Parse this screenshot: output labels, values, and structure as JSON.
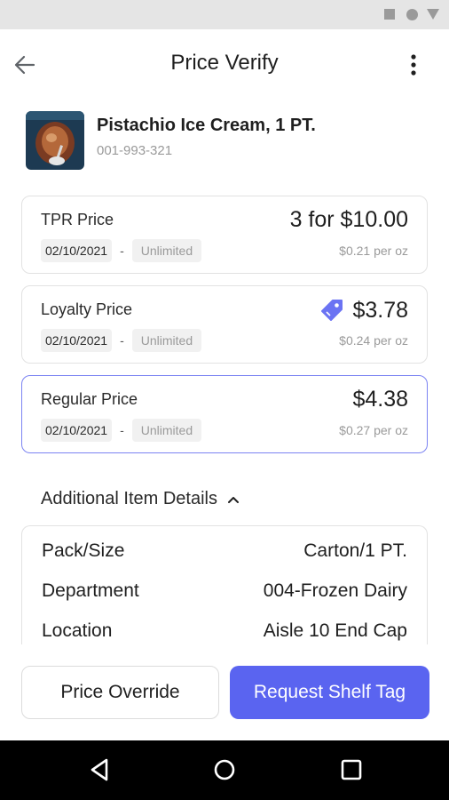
{
  "app": {
    "title": "Price Verify"
  },
  "product": {
    "name": "Pistachio Ice Cream, 1 PT.",
    "sku": "001-993-321"
  },
  "prices": [
    {
      "label": "TPR Price",
      "start": "02/10/2021",
      "end": "Unlimited",
      "price": "3 for $10.00",
      "unit": "$0.21 per oz"
    },
    {
      "label": "Loyalty Price",
      "start": "02/10/2021",
      "end": "Unlimited",
      "price": "$3.78",
      "unit": "$0.24 per oz"
    },
    {
      "label": "Regular Price",
      "start": "02/10/2021",
      "end": "Unlimited",
      "price": "$4.38",
      "unit": "$0.27 per oz"
    }
  ],
  "details": {
    "header": "Additional Item Details",
    "rows": [
      {
        "key": "Pack/Size",
        "value": "Carton/1 PT."
      },
      {
        "key": "Department",
        "value": "004-Frozen Dairy"
      },
      {
        "key": "Location",
        "value": "Aisle 10 End Cap"
      }
    ]
  },
  "actions": {
    "override": "Price Override",
    "request": "Request Shelf Tag"
  },
  "colors": {
    "primary": "#5a64f0",
    "selected_border": "#7b83f2",
    "tag_icon": "#6b73f3"
  },
  "icons": {
    "back": "arrow-left-icon",
    "more": "more-vert-icon",
    "tag": "price-tag-icon",
    "chevron": "chevron-up-icon"
  }
}
